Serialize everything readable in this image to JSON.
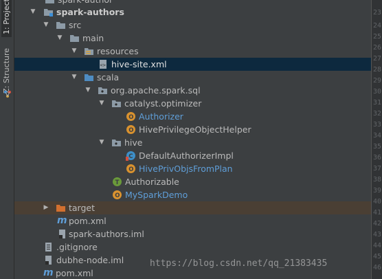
{
  "tool_tabs": {
    "project": "1: Project",
    "structure": "Z: Structure"
  },
  "tree": {
    "truncated_top": "spark-author",
    "module": "spark-authors",
    "src": "src",
    "main": "main",
    "resources": "resources",
    "hive_site": "hive-site.xml",
    "scala": "scala",
    "package": "org.apache.spark.sql",
    "catalyst_pkg": "catalyst.optimizer",
    "authorizer": "Authorizer",
    "helper": "HivePrivilegeObjectHelper",
    "hive_pkg": "hive",
    "default_impl": "DefaultAuthorizerImpl",
    "from_plan": "HivePrivObjsFromPlan",
    "authorizable": "Authorizable",
    "my_demo": "MySparkDemo",
    "target": "target",
    "pom_module": "pom.xml",
    "iml_module": "spark-authors.iml",
    "gitignore": ".gitignore",
    "dubhe_iml": "dubhe-node.iml",
    "pom_root": "pom.xml"
  },
  "line_numbers": [
    "23",
    "24",
    "25",
    "26",
    "27",
    "28",
    "29",
    "30",
    "31",
    "32",
    "33",
    "34",
    "35",
    "36",
    "37",
    "38",
    "39",
    "40",
    "41",
    "42",
    "43",
    "44",
    "45",
    "46"
  ],
  "watermark": "https://blog.csdn.net/qq_21383435",
  "colors": {
    "selection": "#0d293e",
    "excluded_folder": "#4a3f34",
    "link_blue": "#5f9ed8",
    "object_badge": "#d9922f",
    "trait_badge": "#6a9a3a"
  }
}
